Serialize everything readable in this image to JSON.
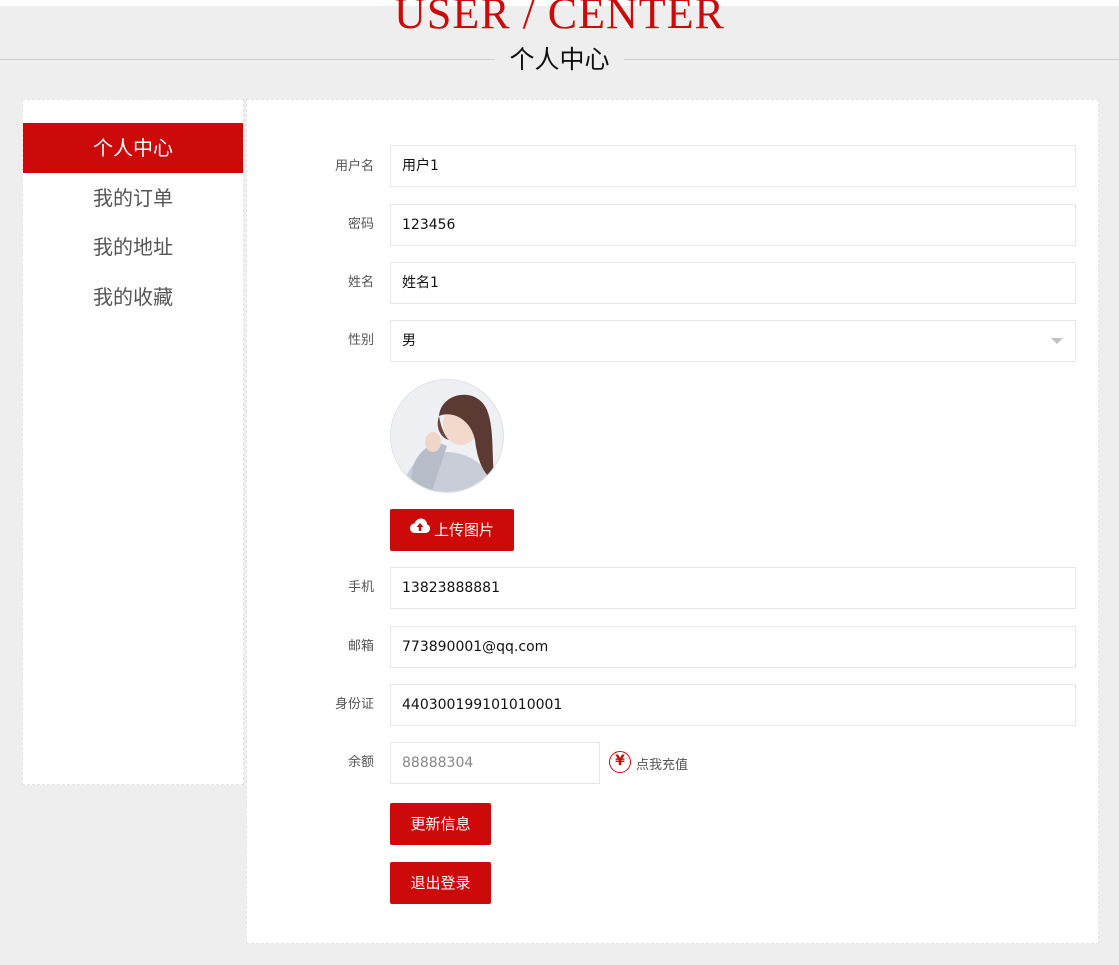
{
  "header": {
    "title_en": "USER / CENTER",
    "title_cn": "个人中心"
  },
  "sidebar": {
    "items": [
      {
        "label": "个人中心",
        "active": true
      },
      {
        "label": "我的订单",
        "active": false
      },
      {
        "label": "我的地址",
        "active": false
      },
      {
        "label": "我的收藏",
        "active": false
      }
    ]
  },
  "form": {
    "username_label": "用户名",
    "username_value": "用户1",
    "password_label": "密码",
    "password_value": "123456",
    "name_label": "姓名",
    "name_value": "姓名1",
    "gender_label": "性别",
    "gender_value": "男",
    "upload_button": "上传图片",
    "phone_label": "手机",
    "phone_value": "13823888881",
    "email_label": "邮箱",
    "email_value": "773890001@qq.com",
    "idcard_label": "身份证",
    "idcard_value": "440300199101010001",
    "balance_label": "余额",
    "balance_value": "88888304",
    "recharge_icon": "¥",
    "recharge_link": "点我充值",
    "update_button": "更新信息",
    "logout_button": "退出登录"
  },
  "colors": {
    "accent": "#cc0a0a",
    "background": "#eeeeee"
  },
  "icons": {
    "upload": "cloud-upload-icon",
    "recharge": "yen-circle-icon",
    "select": "chevron-down-icon"
  }
}
